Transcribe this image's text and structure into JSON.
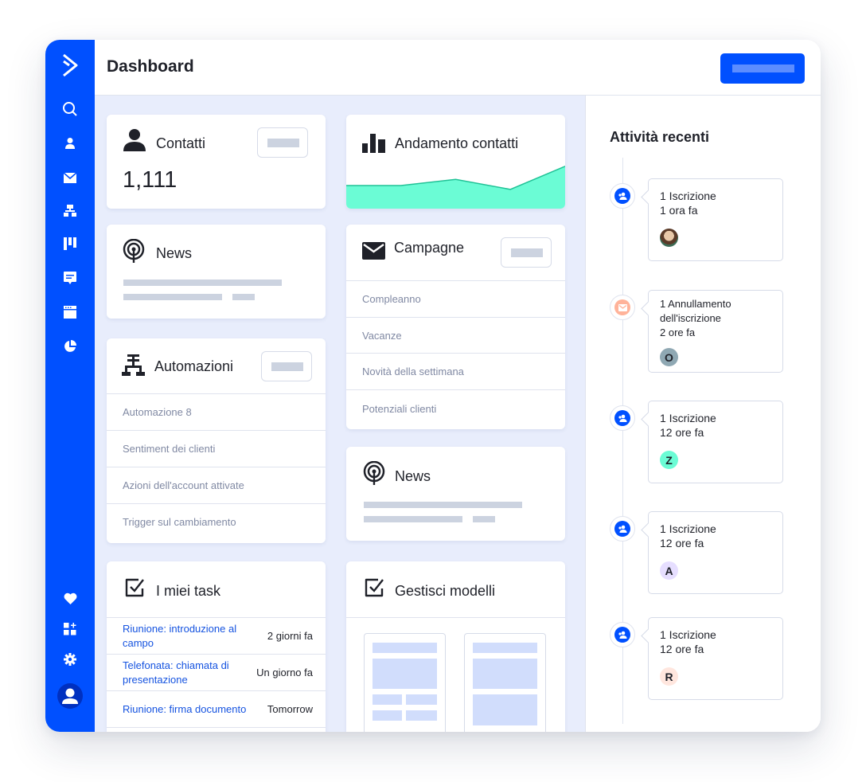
{
  "header": {
    "title": "Dashboard",
    "primary_button_label": ""
  },
  "sidebar": {
    "logo": "activecampaign-chevron-logo",
    "items": [
      {
        "name": "search",
        "icon": "search-icon"
      },
      {
        "name": "contacts",
        "icon": "person-icon"
      },
      {
        "name": "campaigns",
        "icon": "envelope-icon"
      },
      {
        "name": "automations",
        "icon": "sitemap-icon"
      },
      {
        "name": "deals",
        "icon": "kanban-icon"
      },
      {
        "name": "conversations",
        "icon": "chat-icon"
      },
      {
        "name": "website",
        "icon": "browser-icon"
      },
      {
        "name": "reports",
        "icon": "pie-chart-icon"
      }
    ],
    "bottom_items": [
      {
        "name": "favorites",
        "icon": "heart-icon"
      },
      {
        "name": "apps",
        "icon": "apps-add-icon"
      },
      {
        "name": "settings",
        "icon": "gear-icon"
      },
      {
        "name": "account",
        "icon": "user-avatar-icon"
      }
    ]
  },
  "cards": {
    "contacts": {
      "title": "Contatti",
      "value": "1,111"
    },
    "trend": {
      "title": "Andamento contatti"
    },
    "news1": {
      "title": "News"
    },
    "campaigns": {
      "title": "Campagne",
      "items": [
        "Compleanno",
        "Vacanze",
        "Novità della settimana",
        "Potenziali clienti"
      ]
    },
    "automations": {
      "title": "Automazioni",
      "items": [
        "Automazione 8",
        "Sentiment dei clienti",
        "Azioni dell'account attivate",
        "Trigger sul cambiamento"
      ]
    },
    "news2": {
      "title": "News"
    },
    "tasks": {
      "title": "I miei task",
      "items": [
        {
          "name": "Riunione: introduzione al campo",
          "time": "2 giorni fa"
        },
        {
          "name": "Telefonata: chiamata di presentazione",
          "time": "Un giorno fa"
        },
        {
          "name": "Riunione: firma documento",
          "time": "Tomorrow"
        }
      ]
    },
    "templates": {
      "title": "Gestisci modelli"
    }
  },
  "chart_data": {
    "type": "area",
    "title": "Andamento contatti",
    "x": [
      0,
      1,
      2,
      3,
      4
    ],
    "values": [
      30,
      30,
      38,
      25,
      55
    ],
    "ylim": [
      0,
      60
    ],
    "fill_color": "#6bfcd5",
    "line_color": "#20c296"
  },
  "activity": {
    "title": "Attività recenti",
    "items": [
      {
        "type": "subscribe",
        "line1": "1 Iscrizione",
        "line2": "1 ora fa",
        "avatar": "photo",
        "avatar_color": "#c9b8a0"
      },
      {
        "type": "unsubscribe",
        "line1": "1 Annullamento dell'iscrizione",
        "line2": "2 ore fa",
        "avatar": "O",
        "avatar_color": "#8fa8b3"
      },
      {
        "type": "subscribe",
        "line1": "1 Iscrizione",
        "line2": "12 ore fa",
        "avatar": "Z",
        "avatar_color": "#6bfcd5"
      },
      {
        "type": "subscribe",
        "line1": "1 Iscrizione",
        "line2": "12 ore fa",
        "avatar": "A",
        "avatar_color": "#e6deff"
      },
      {
        "type": "subscribe",
        "line1": "1 Iscrizione",
        "line2": "12 ore fa",
        "avatar": "R",
        "avatar_color": "#ffe6de"
      }
    ]
  },
  "colors": {
    "brand": "#0050ff",
    "page_bg": "#e8edfc",
    "link": "#1553e0",
    "unsubscribe": "#ff9a7a"
  }
}
